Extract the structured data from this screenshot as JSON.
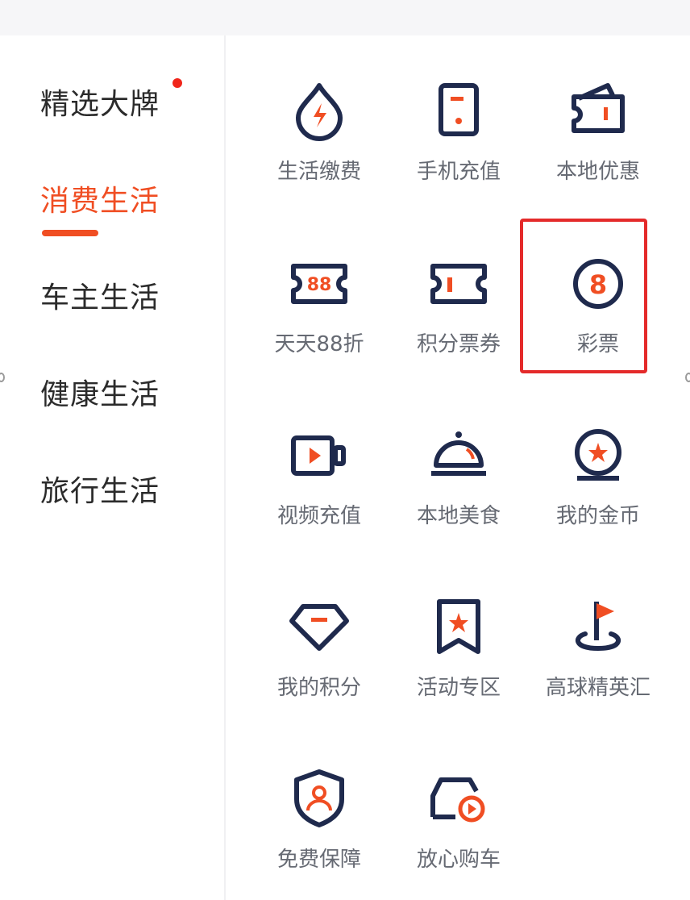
{
  "colors": {
    "accent": "#f04e23",
    "icon_navy": "#1f2a4d",
    "icon_red": "#f04e23",
    "highlight": "#e42a2a"
  },
  "sidebar": {
    "items": [
      {
        "label": "精选大牌",
        "has_dot": true
      },
      {
        "label": "消费生活",
        "active": true
      },
      {
        "label": "车主生活"
      },
      {
        "label": "健康生活"
      },
      {
        "label": "旅行生活"
      }
    ]
  },
  "grid": {
    "items": [
      {
        "label": "生活缴费",
        "icon": "water-drop-bolt-icon"
      },
      {
        "label": "手机充值",
        "icon": "phone-icon"
      },
      {
        "label": "本地优惠",
        "icon": "wallet-icon"
      },
      {
        "label": "天天88折",
        "icon": "ticket-88-icon"
      },
      {
        "label": "积分票券",
        "icon": "ticket-icon"
      },
      {
        "label": "彩票",
        "icon": "lottery-ball-icon",
        "highlighted": true
      },
      {
        "label": "视频充值",
        "icon": "video-camera-icon"
      },
      {
        "label": "本地美食",
        "icon": "food-cloche-icon"
      },
      {
        "label": "我的金币",
        "icon": "coin-star-icon"
      },
      {
        "label": "我的积分",
        "icon": "diamond-icon"
      },
      {
        "label": "活动专区",
        "icon": "bookmark-star-icon"
      },
      {
        "label": "高球精英汇",
        "icon": "golf-flag-icon"
      },
      {
        "label": "免费保障",
        "icon": "shield-user-icon"
      },
      {
        "label": "放心购车",
        "icon": "car-play-icon"
      }
    ]
  }
}
